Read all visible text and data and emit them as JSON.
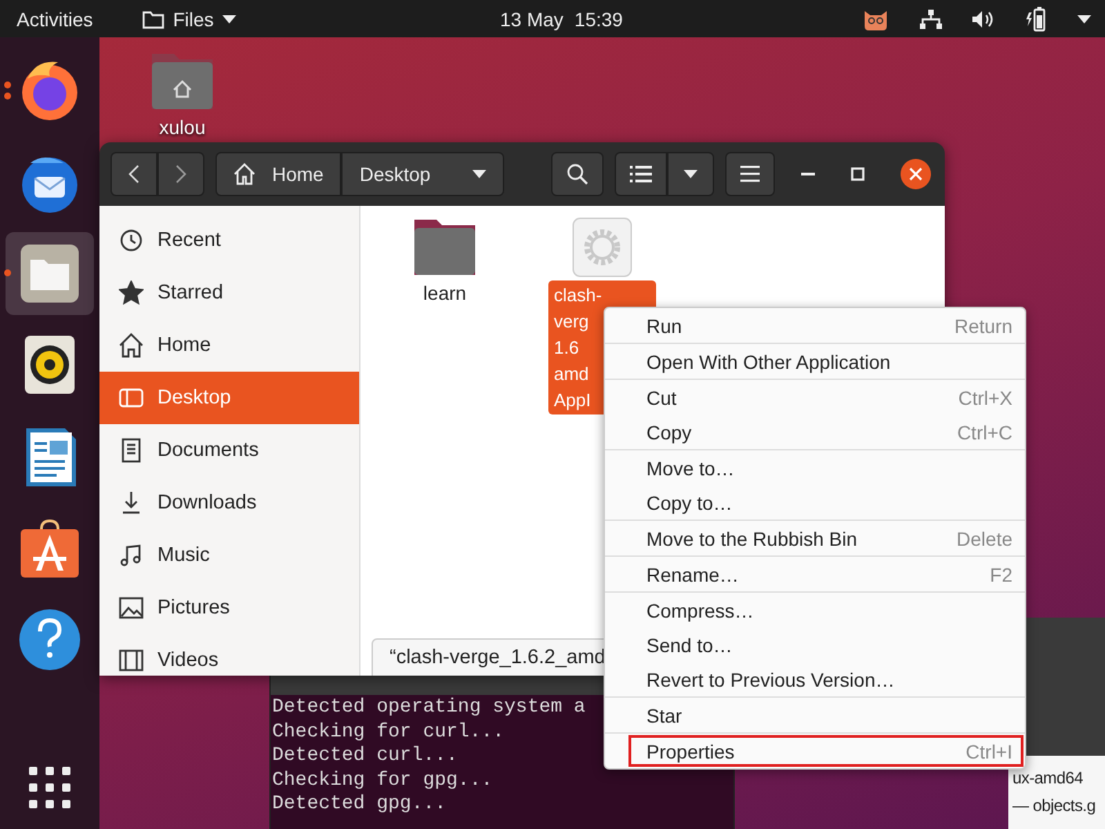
{
  "top_bar": {
    "activities": "Activities",
    "app_menu": "Files",
    "date": "13 May",
    "time": "15:39"
  },
  "dock": [
    {
      "kind": "firefox",
      "running": true,
      "multiple_windows": true,
      "selected": false
    },
    {
      "kind": "thunderbird",
      "running": false,
      "selected": false
    },
    {
      "kind": "files",
      "running": true,
      "selected": true
    },
    {
      "kind": "rhythmbox",
      "running": false,
      "selected": false
    },
    {
      "kind": "writer",
      "running": false,
      "selected": false
    },
    {
      "kind": "software",
      "running": false,
      "selected": false
    },
    {
      "kind": "help",
      "running": false,
      "selected": false
    },
    {
      "kind": "apps",
      "running": false,
      "selected": false
    }
  ],
  "desktop_icons": [
    {
      "label": "xulou"
    }
  ],
  "files_window": {
    "path": [
      "Home",
      "Desktop"
    ],
    "sidebar": [
      {
        "label": "Recent",
        "kind": "recent",
        "selected": false
      },
      {
        "label": "Starred",
        "kind": "starred",
        "selected": false
      },
      {
        "label": "Home",
        "kind": "home",
        "selected": false
      },
      {
        "label": "Desktop",
        "kind": "desktop",
        "selected": true
      },
      {
        "label": "Documents",
        "kind": "documents",
        "selected": false
      },
      {
        "label": "Downloads",
        "kind": "downloads",
        "selected": false
      },
      {
        "label": "Music",
        "kind": "music",
        "selected": false
      },
      {
        "label": "Pictures",
        "kind": "pictures",
        "selected": false
      },
      {
        "label": "Videos",
        "kind": "videos",
        "selected": false
      }
    ],
    "files": [
      {
        "kind": "folder",
        "name_lines": [
          "learn"
        ],
        "selected": false
      },
      {
        "kind": "app",
        "name_lines": [
          "clash-",
          "verg",
          "1.6",
          "amd",
          "AppI"
        ],
        "selected": true
      }
    ],
    "status": "“clash-verge_1.6.2_amd"
  },
  "terminal": {
    "lines": [
      "Detected operating system a",
      "Checking for curl...",
      "Detected curl...",
      "Checking for gpg...",
      "Detected gpg..."
    ]
  },
  "right_window": {
    "lines": [
      "ux-amd64",
      "— objects.g"
    ]
  },
  "context_menu": [
    [
      {
        "label": "Run",
        "shortcut": "Return",
        "highlighted": false
      }
    ],
    [
      {
        "label": "Open With Other Application",
        "highlighted": false
      }
    ],
    [
      {
        "label": "Cut",
        "shortcut": "Ctrl+X",
        "highlighted": false
      },
      {
        "label": "Copy",
        "shortcut": "Ctrl+C",
        "highlighted": false
      }
    ],
    [
      {
        "label": "Move to…",
        "highlighted": false
      },
      {
        "label": "Copy to…",
        "highlighted": false
      }
    ],
    [
      {
        "label": "Move to the Rubbish Bin",
        "shortcut": "Delete",
        "highlighted": false
      }
    ],
    [
      {
        "label": "Rename…",
        "shortcut": "F2",
        "highlighted": false
      }
    ],
    [
      {
        "label": "Compress…",
        "highlighted": false
      },
      {
        "label": "Send to…",
        "highlighted": false
      },
      {
        "label": "Revert to Previous Version…",
        "highlighted": false
      }
    ],
    [
      {
        "label": "Star",
        "highlighted": false
      }
    ],
    [
      {
        "label": "Properties",
        "shortcut": "Ctrl+I",
        "highlighted": true
      }
    ]
  ]
}
